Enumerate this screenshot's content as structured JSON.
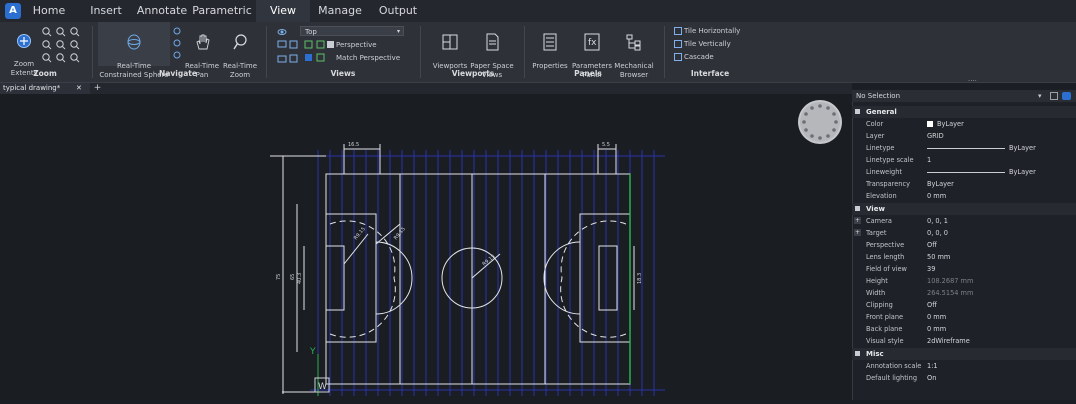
{
  "app": {
    "logo_letter": "A"
  },
  "menu_tabs": [
    "Home",
    "Insert",
    "Annotate",
    "Parametric",
    "View",
    "Manage",
    "Output"
  ],
  "ribbon": {
    "zoom": {
      "extents_label": "Zoom\nExtents",
      "group": "Zoom"
    },
    "navigate": {
      "sphere": "Real-Time\nConstrained Sphere",
      "pan": "Real-Time\nPan",
      "zoom": "Real-Time\nZoom",
      "group": "Navigate"
    },
    "views": {
      "view_select": "Top",
      "perspective": "Perspective",
      "match_perspective": "Match Perspective",
      "group": "Views"
    },
    "viewports": {
      "viewports": "Viewports",
      "paper_space": "Paper Space\nViews",
      "group": "Viewports"
    },
    "panels": {
      "properties": "Properties",
      "parameters": "Parameters\nPanel",
      "mechanical": "Mechanical\nBrowser",
      "group": "Panels"
    },
    "interface": {
      "tile_h": "Tile Horizontally",
      "tile_v": "Tile Vertically",
      "cascade": "Cascade",
      "group": "Interface"
    },
    "more": "...."
  },
  "document": {
    "tab_title": "typical drawing*",
    "close": "✕",
    "add": "+"
  },
  "drawing": {
    "dims": {
      "d1": "16.5",
      "d2": "5.5",
      "d3": "75",
      "d4": "65",
      "d5": "40.3",
      "d6": "18.3",
      "r1": "R9.15",
      "r2": "R9.15",
      "r3": "R9.15"
    },
    "ucs": {
      "y": "Y",
      "w": "W"
    }
  },
  "properties": {
    "selection": "No Selection",
    "general_title": "General",
    "general": [
      {
        "k": "Color",
        "v": "ByLayer",
        "swatch": true
      },
      {
        "k": "Layer",
        "v": "GRID"
      },
      {
        "k": "Linetype",
        "v": "ByLayer",
        "line": true
      },
      {
        "k": "Linetype scale",
        "v": "1"
      },
      {
        "k": "Lineweight",
        "v": "ByLayer",
        "line": true
      },
      {
        "k": "Transparency",
        "v": "ByLayer"
      },
      {
        "k": "Elevation",
        "v": "0 mm"
      }
    ],
    "view_title": "View",
    "view": [
      {
        "k": "Camera",
        "v": "0, 0, 1",
        "plus": true
      },
      {
        "k": "Target",
        "v": "0, 0, 0",
        "plus": true
      },
      {
        "k": "Perspective",
        "v": "Off"
      },
      {
        "k": "Lens length",
        "v": "50 mm"
      },
      {
        "k": "Field of view",
        "v": "39"
      },
      {
        "k": "Height",
        "v": "108.2687 mm",
        "dim": true
      },
      {
        "k": "Width",
        "v": "264.5154 mm",
        "dim": true
      },
      {
        "k": "Clipping",
        "v": "Off"
      },
      {
        "k": "Front plane",
        "v": "0 mm"
      },
      {
        "k": "Back plane",
        "v": "0 mm"
      },
      {
        "k": "Visual style",
        "v": "2dWireframe"
      }
    ],
    "misc_title": "Misc",
    "misc": [
      {
        "k": "Annotation scale",
        "v": "1:1"
      },
      {
        "k": "Default lighting",
        "v": "On"
      }
    ]
  }
}
